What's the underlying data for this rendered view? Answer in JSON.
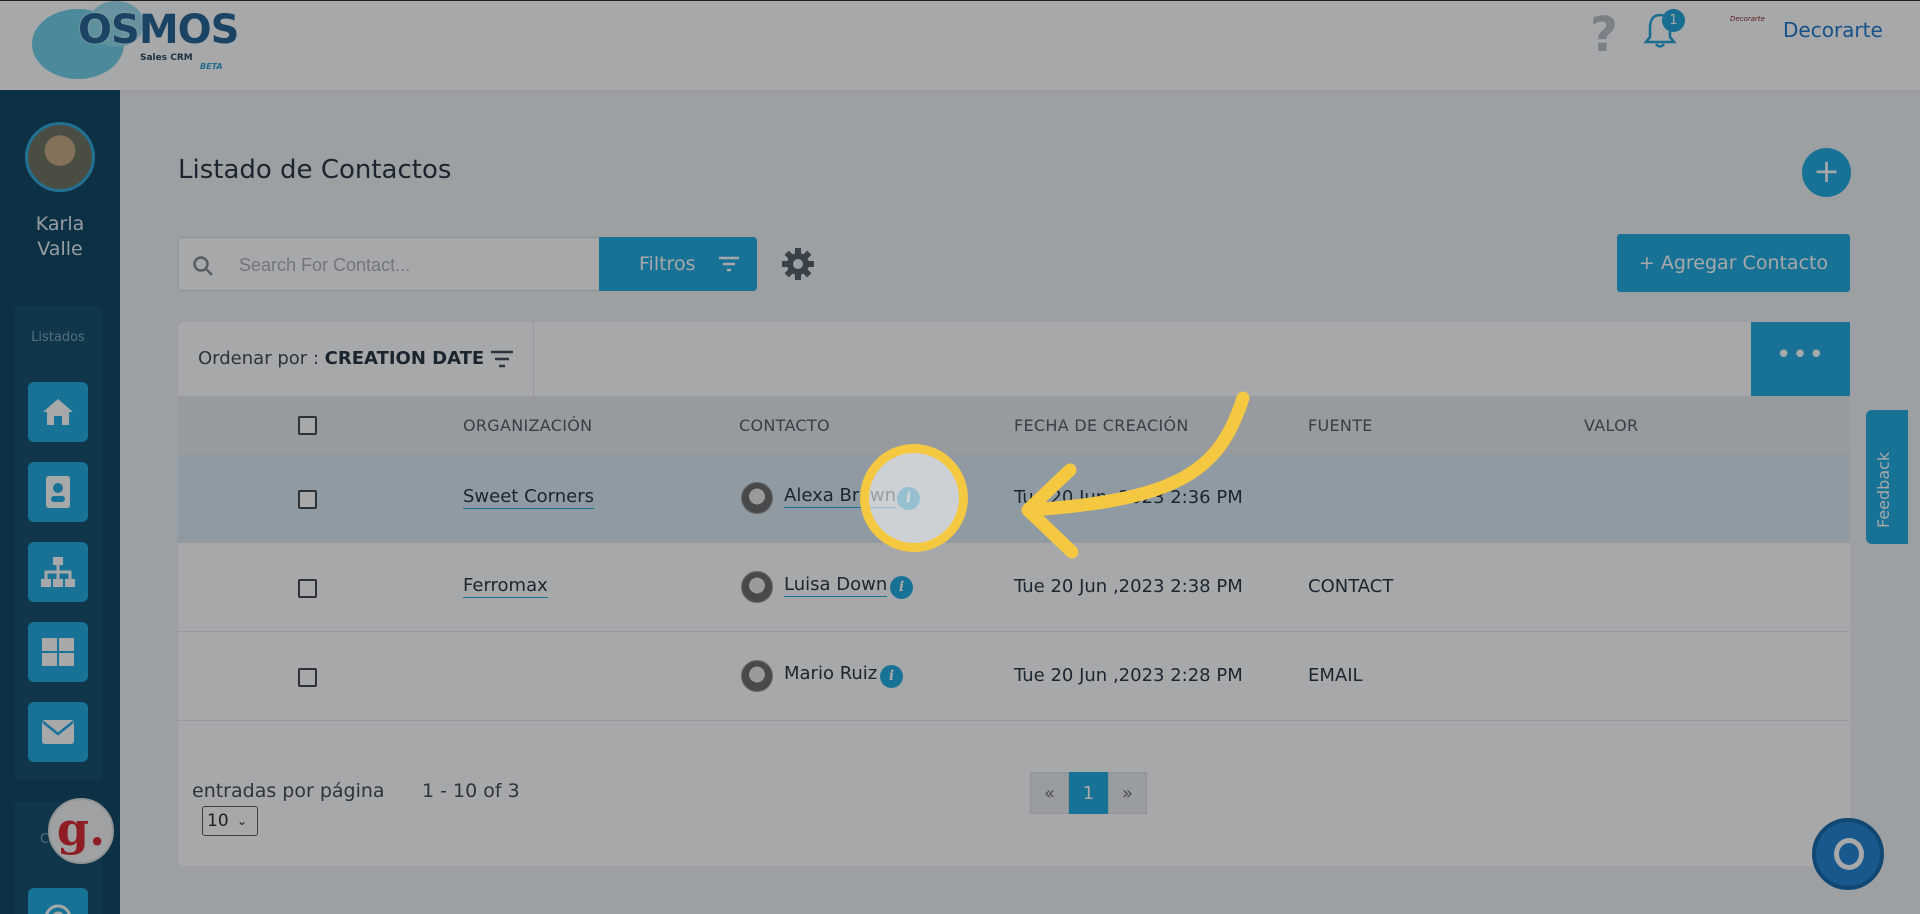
{
  "topbar": {
    "logo_text": "OSMOS",
    "logo_tagline": "Sales CRM",
    "logo_beta": "BETA",
    "help_icon": "question-mark-icon",
    "notification_count": "1",
    "company_logo_text": "Decorarte",
    "company_name": "Decorarte"
  },
  "sidebar": {
    "user_first": "Karla",
    "user_last": "Valle",
    "section_label": "Listados",
    "items": [
      {
        "icon": "home-icon"
      },
      {
        "icon": "contact-card-icon"
      },
      {
        "icon": "org-chart-icon"
      },
      {
        "icon": "grid-icon"
      },
      {
        "icon": "mail-icon"
      }
    ],
    "section2_label": "C",
    "badge_letter": "g."
  },
  "main": {
    "title": "Listado de Contactos",
    "search_placeholder": "Search For Contact...",
    "filter_label": "Filtros",
    "add_contact_label": "+ Agregar Contacto",
    "sort_prefix": "Ordenar por : ",
    "sort_value": "CREATION DATE",
    "more_label": "•••"
  },
  "table": {
    "headers": {
      "org": "ORGANIZACIÓN",
      "contact": "CONTACTO",
      "date": "FECHA DE CREACIÓN",
      "source": "FUENTE",
      "value": "VALOR"
    },
    "rows": [
      {
        "org": "Sweet Corners",
        "contact": "Alexa Brown",
        "date": "Tue 20 Jun ,2023 2:36 PM",
        "source": "",
        "value": ""
      },
      {
        "org": "Ferromax",
        "contact": "Luisa Down",
        "date": "Tue 20 Jun ,2023 2:38 PM",
        "source": "CONTACT",
        "value": ""
      },
      {
        "org": "",
        "contact": "Mario Ruiz",
        "date": "Tue 20 Jun ,2023 2:28 PM",
        "source": "EMAIL",
        "value": ""
      }
    ]
  },
  "footer": {
    "entries_label": "entradas por página",
    "range": "1 - 10 of 3",
    "per_page": "10",
    "prev": "«",
    "page": "1",
    "next": "»"
  },
  "feedback_label": "Feedback",
  "colors": {
    "accent": "#1aa8e0",
    "sidebar": "#083e5c",
    "highlight": "#f5c842"
  }
}
